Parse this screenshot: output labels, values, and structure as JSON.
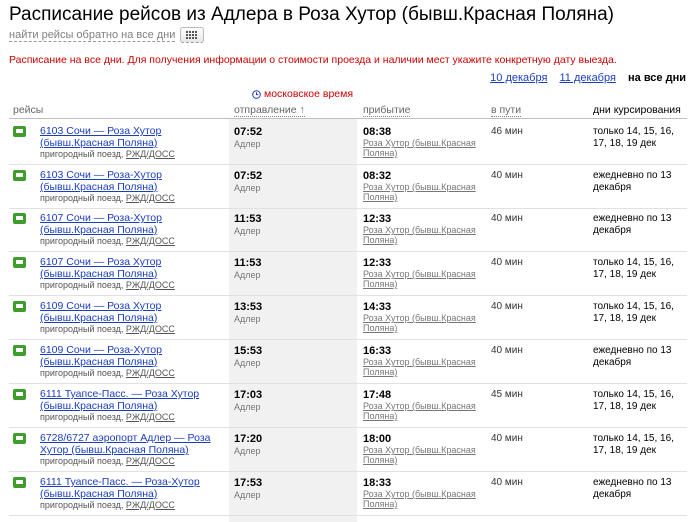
{
  "page_title": "Расписание рейсов из Адлера в Роза Хутор (бывш.Красная Поляна)",
  "reverse_link": "найти рейсы обратно на все дни",
  "notice": "Расписание на все дни. Для получения информации о стоимости проезда и наличии мест укажите конкретную дату выезда.",
  "date_links": [
    "10 декабря",
    "11 декабря"
  ],
  "date_current": "на все дни",
  "timezone_label": "московское время",
  "columns": {
    "route": "рейсы",
    "departure": "отправление ↑",
    "arrival": "прибытие",
    "duration": "в пути",
    "days": "дни курсирования"
  },
  "icons": {
    "train": "train-icon",
    "clock": "clock-icon",
    "calendar": "calendar-icon"
  },
  "colors": {
    "link": "#1a3dc1",
    "alert": "#cc0000",
    "train_icon": "#3e9d2d"
  },
  "train_type": "пригородный поезд,",
  "carrier": "РЖД/ДОСС",
  "rows": [
    {
      "name": "6103 Сочи — Роза Хутор (бывш.Красная Поляна)",
      "dep": "07:52",
      "dep_station": "Адлер",
      "arr": "08:38",
      "arr_station": "Роза Хутор (бывш.Красная Поляна)",
      "duration": "46 мин",
      "days": "только 14, 15, 16, 17, 18, 19 дек"
    },
    {
      "name": "6103 Сочи — Роза-Хутор (бывш.Красная Поляна)",
      "dep": "07:52",
      "dep_station": "Адлер",
      "arr": "08:32",
      "arr_station": "Роза Хутор (бывш.Красная Поляна)",
      "duration": "40 мин",
      "days": "ежедневно по 13 декабря"
    },
    {
      "name": "6107 Сочи — Роза-Хутор (бывш.Красная Поляна)",
      "dep": "11:53",
      "dep_station": "Адлер",
      "arr": "12:33",
      "arr_station": "Роза Хутор (бывш.Красная Поляна)",
      "duration": "40 мин",
      "days": "ежедневно по 13 декабря"
    },
    {
      "name": "6107 Сочи — Роза Хутор (бывш.Красная Поляна)",
      "dep": "11:53",
      "dep_station": "Адлер",
      "arr": "12:33",
      "arr_station": "Роза Хутор (бывш.Красная Поляна)",
      "duration": "40 мин",
      "days": "только 14, 15, 16, 17, 18, 19 дек"
    },
    {
      "name": "6109 Сочи — Роза Хутор (бывш.Красная Поляна)",
      "dep": "13:53",
      "dep_station": "Адлер",
      "arr": "14:33",
      "arr_station": "Роза Хутор (бывш.Красная Поляна)",
      "duration": "40 мин",
      "days": "только 14, 15, 16, 17, 18, 19 дек"
    },
    {
      "name": "6109 Сочи — Роза-Хутор (бывш.Красная Поляна)",
      "dep": "15:53",
      "dep_station": "Адлер",
      "arr": "16:33",
      "arr_station": "Роза Хутор (бывш.Красная Поляна)",
      "duration": "40 мин",
      "days": "ежедневно по 13 декабря"
    },
    {
      "name": "6111 Туапсе-Пасс. — Роза Хутор (бывш.Красная Поляна)",
      "dep": "17:03",
      "dep_station": "Адлер",
      "arr": "17:48",
      "arr_station": "Роза Хутор (бывш.Красная Поляна)",
      "duration": "45 мин",
      "days": "только 14, 15, 16, 17, 18, 19 дек"
    },
    {
      "name": "6728/6727 аэропорт Адлер — Роза Хутор (бывш.Красная Поляна)",
      "dep": "17:20",
      "dep_station": "Адлер",
      "arr": "18:00",
      "arr_station": "Роза Хутор (бывш.Красная Поляна)",
      "duration": "40 мин",
      "days": "только 14, 15, 16, 17, 18, 19 дек"
    },
    {
      "name": "6111 Туапсе-Пасс. — Роза-Хутор (бывш.Красная Поляна)",
      "dep": "17:53",
      "dep_station": "Адлер",
      "arr": "18:33",
      "arr_station": "Роза Хутор (бывш.Красная Поляна)",
      "duration": "40 мин",
      "days": "ежедневно по 13 декабря"
    }
  ]
}
